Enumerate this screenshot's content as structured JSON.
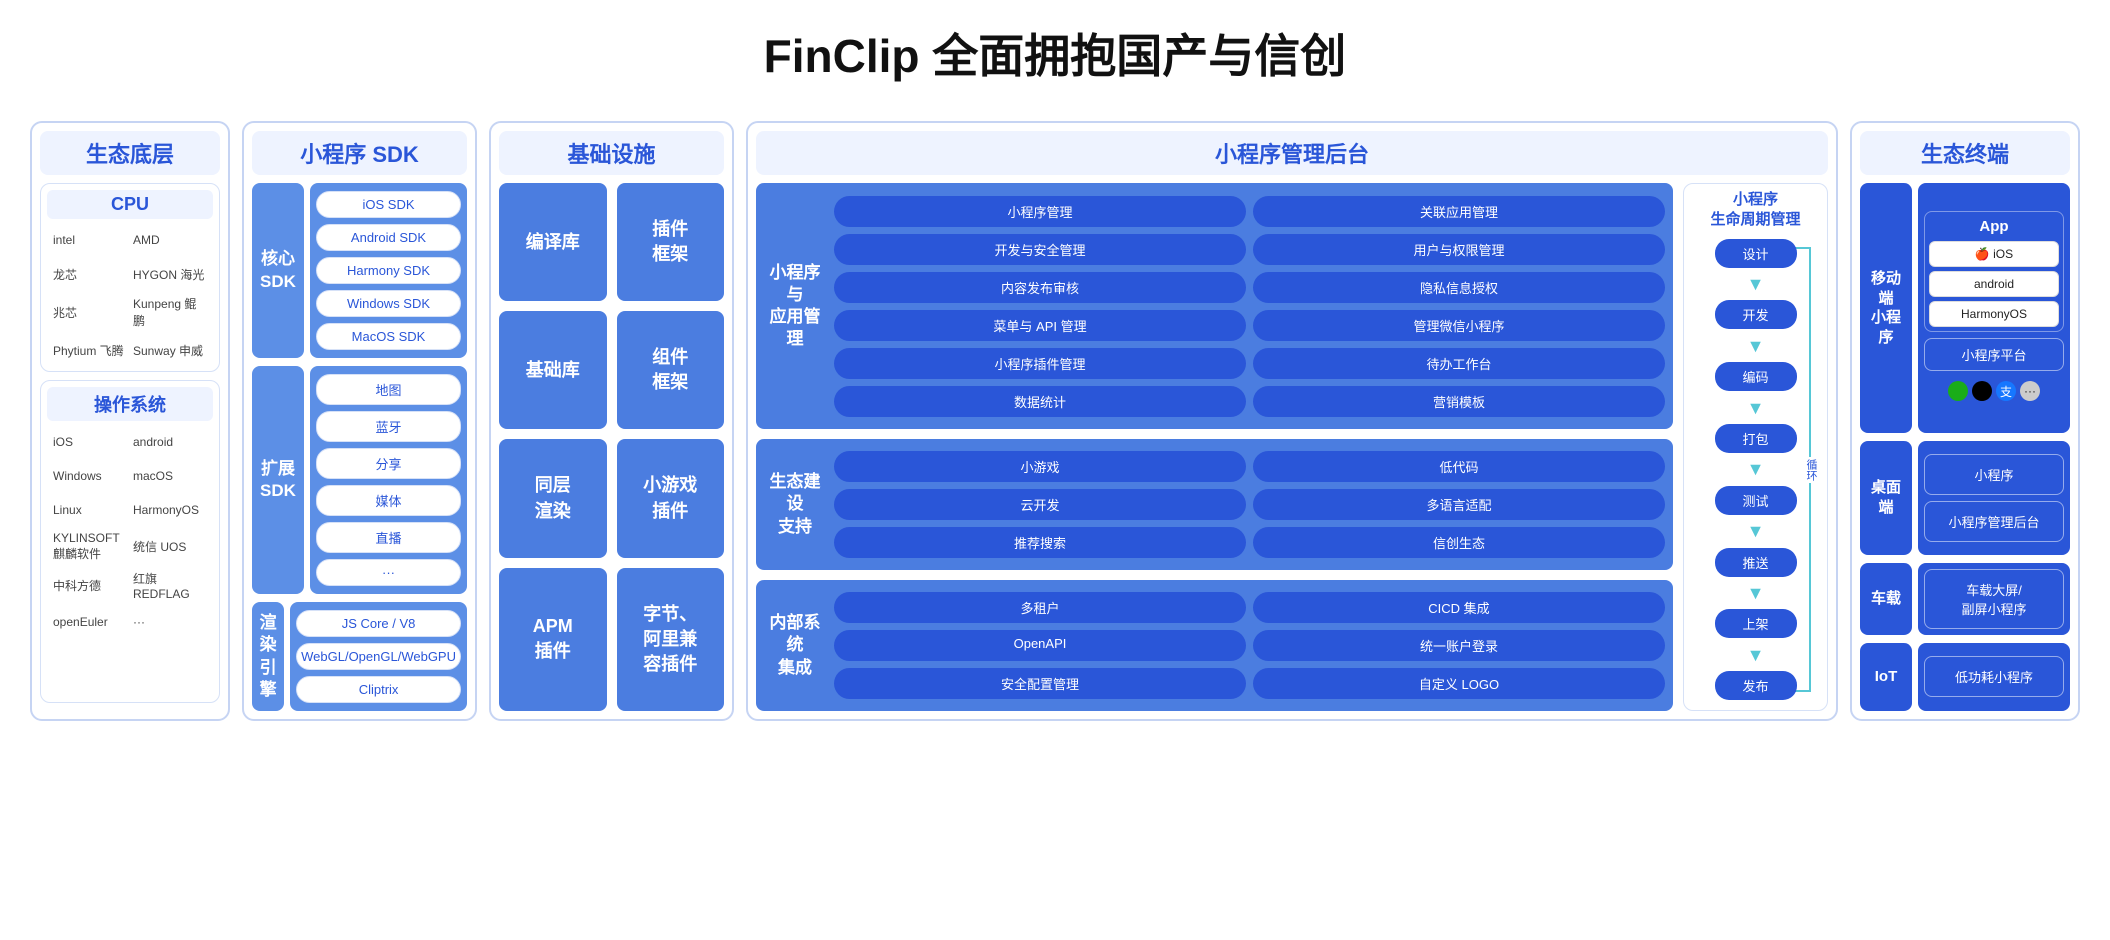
{
  "title": "FinClip 全面拥抱国产与信创",
  "columns": {
    "ecosystem_bottom": {
      "header": "生态底层",
      "cpu": {
        "title": "CPU",
        "logos": [
          "intel",
          "AMD",
          "龙芯",
          "HYGON 海光",
          "兆芯",
          "Kunpeng 鲲鹏",
          "Phytium 飞腾",
          "Sunway 申威"
        ]
      },
      "os": {
        "title": "操作系统",
        "logos": [
          "iOS",
          "android",
          "Windows",
          "macOS",
          "Linux",
          "HarmonyOS",
          "KYLINSOFT 麒麟软件",
          "统信 UOS",
          "中科方德",
          "红旗 REDFLAG",
          "openEuler",
          "···"
        ]
      }
    },
    "sdk": {
      "header": "小程序 SDK",
      "groups": [
        {
          "side": "核心\nSDK",
          "items": [
            "iOS SDK",
            "Android SDK",
            "Harmony SDK",
            "Windows SDK",
            "MacOS SDK"
          ]
        },
        {
          "side": "扩展\nSDK",
          "items": [
            "地图",
            "蓝牙",
            "分享",
            "媒体",
            "直播",
            "···"
          ]
        },
        {
          "side": "渲染\n引擎",
          "items": [
            "JS Core / V8",
            "WebGL/OpenGL/WebGPU",
            "Cliptrix"
          ]
        }
      ]
    },
    "infra": {
      "header": "基础设施",
      "boxes": [
        "编译库",
        "插件\n框架",
        "基础库",
        "组件\n框架",
        "同层\n渲染",
        "小游戏\n插件",
        "APM\n插件",
        "字节、\n阿里兼\n容插件"
      ]
    },
    "admin": {
      "header": "小程序管理后台",
      "blocks": [
        {
          "title": "小程序与\n应用管理",
          "pills": [
            "小程序管理",
            "关联应用管理",
            "开发与安全管理",
            "用户与权限管理",
            "内容发布审核",
            "隐私信息授权",
            "菜单与 API 管理",
            "管理微信小程序",
            "小程序插件管理",
            "待办工作台",
            "数据统计",
            "营销模板"
          ]
        },
        {
          "title": "生态建设\n支持",
          "pills": [
            "小游戏",
            "低代码",
            "云开发",
            "多语言适配",
            "推荐搜索",
            "信创生态"
          ]
        },
        {
          "title": "内部系统\n集成",
          "pills": [
            "多租户",
            "CICD 集成",
            "OpenAPI",
            "统一账户登录",
            "安全配置管理",
            "自定义 LOGO"
          ]
        }
      ],
      "lifecycle": {
        "title": "小程序\n生命周期管理",
        "cycle_label": "循环",
        "steps": [
          "设计",
          "开发",
          "编码",
          "打包",
          "测试",
          "推送",
          "上架",
          "发布"
        ]
      }
    },
    "terminal": {
      "header": "生态终端",
      "rows": [
        {
          "side": "移动端\n小程序",
          "app_title": "App",
          "apps": [
            "🍎 iOS",
            "android",
            "HarmonyOS"
          ],
          "platform": "小程序平台"
        },
        {
          "side": "桌面端",
          "items": [
            "小程序",
            "小程序管理后台"
          ]
        },
        {
          "side": "车载",
          "items": [
            "车载大屏/\n副屏小程序"
          ]
        },
        {
          "side": "IoT",
          "items": [
            "低功耗小程序"
          ]
        }
      ]
    }
  }
}
